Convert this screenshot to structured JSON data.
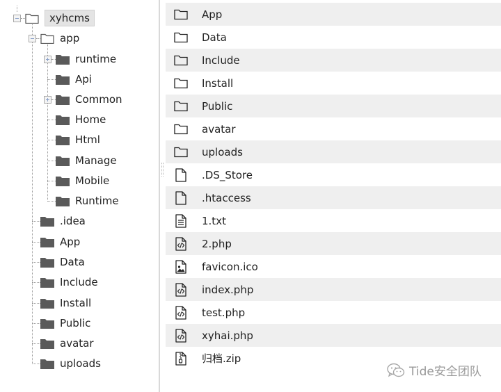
{
  "tree": {
    "root": {
      "label": "xyhcms"
    },
    "app": {
      "label": "app",
      "children": [
        {
          "label": "runtime"
        },
        {
          "label": "Api"
        },
        {
          "label": "Common"
        },
        {
          "label": "Home"
        },
        {
          "label": "Html"
        },
        {
          "label": "Manage"
        },
        {
          "label": "Mobile"
        },
        {
          "label": "Runtime"
        }
      ]
    },
    "root_children": [
      {
        "label": ".idea"
      },
      {
        "label": "App"
      },
      {
        "label": "Data"
      },
      {
        "label": "Include"
      },
      {
        "label": "Install"
      },
      {
        "label": "Public"
      },
      {
        "label": "avatar"
      },
      {
        "label": "uploads"
      }
    ]
  },
  "files": [
    {
      "name": "App",
      "icon": "folder-outline-icon"
    },
    {
      "name": "Data",
      "icon": "folder-outline-icon"
    },
    {
      "name": "Include",
      "icon": "folder-outline-icon"
    },
    {
      "name": "Install",
      "icon": "folder-outline-icon"
    },
    {
      "name": "Public",
      "icon": "folder-outline-icon"
    },
    {
      "name": "avatar",
      "icon": "folder-outline-icon"
    },
    {
      "name": "uploads",
      "icon": "folder-outline-icon"
    },
    {
      "name": ".DS_Store",
      "icon": "file-icon"
    },
    {
      "name": ".htaccess",
      "icon": "file-icon"
    },
    {
      "name": "1.txt",
      "icon": "text-file-icon"
    },
    {
      "name": "2.php",
      "icon": "code-file-icon"
    },
    {
      "name": "favicon.ico",
      "icon": "image-file-icon"
    },
    {
      "name": "index.php",
      "icon": "code-file-icon"
    },
    {
      "name": "test.php",
      "icon": "code-file-icon"
    },
    {
      "name": "xyhai.php",
      "icon": "code-file-icon"
    },
    {
      "name": "归档.zip",
      "icon": "zip-file-icon"
    }
  ],
  "watermark": {
    "text": "Tide安全团队",
    "icon": "wechat-logo-icon"
  },
  "colors": {
    "row_stripe": "#efefef",
    "folder_fill": "#5a5a5a",
    "toggle_sign": "#8ba1c9"
  }
}
